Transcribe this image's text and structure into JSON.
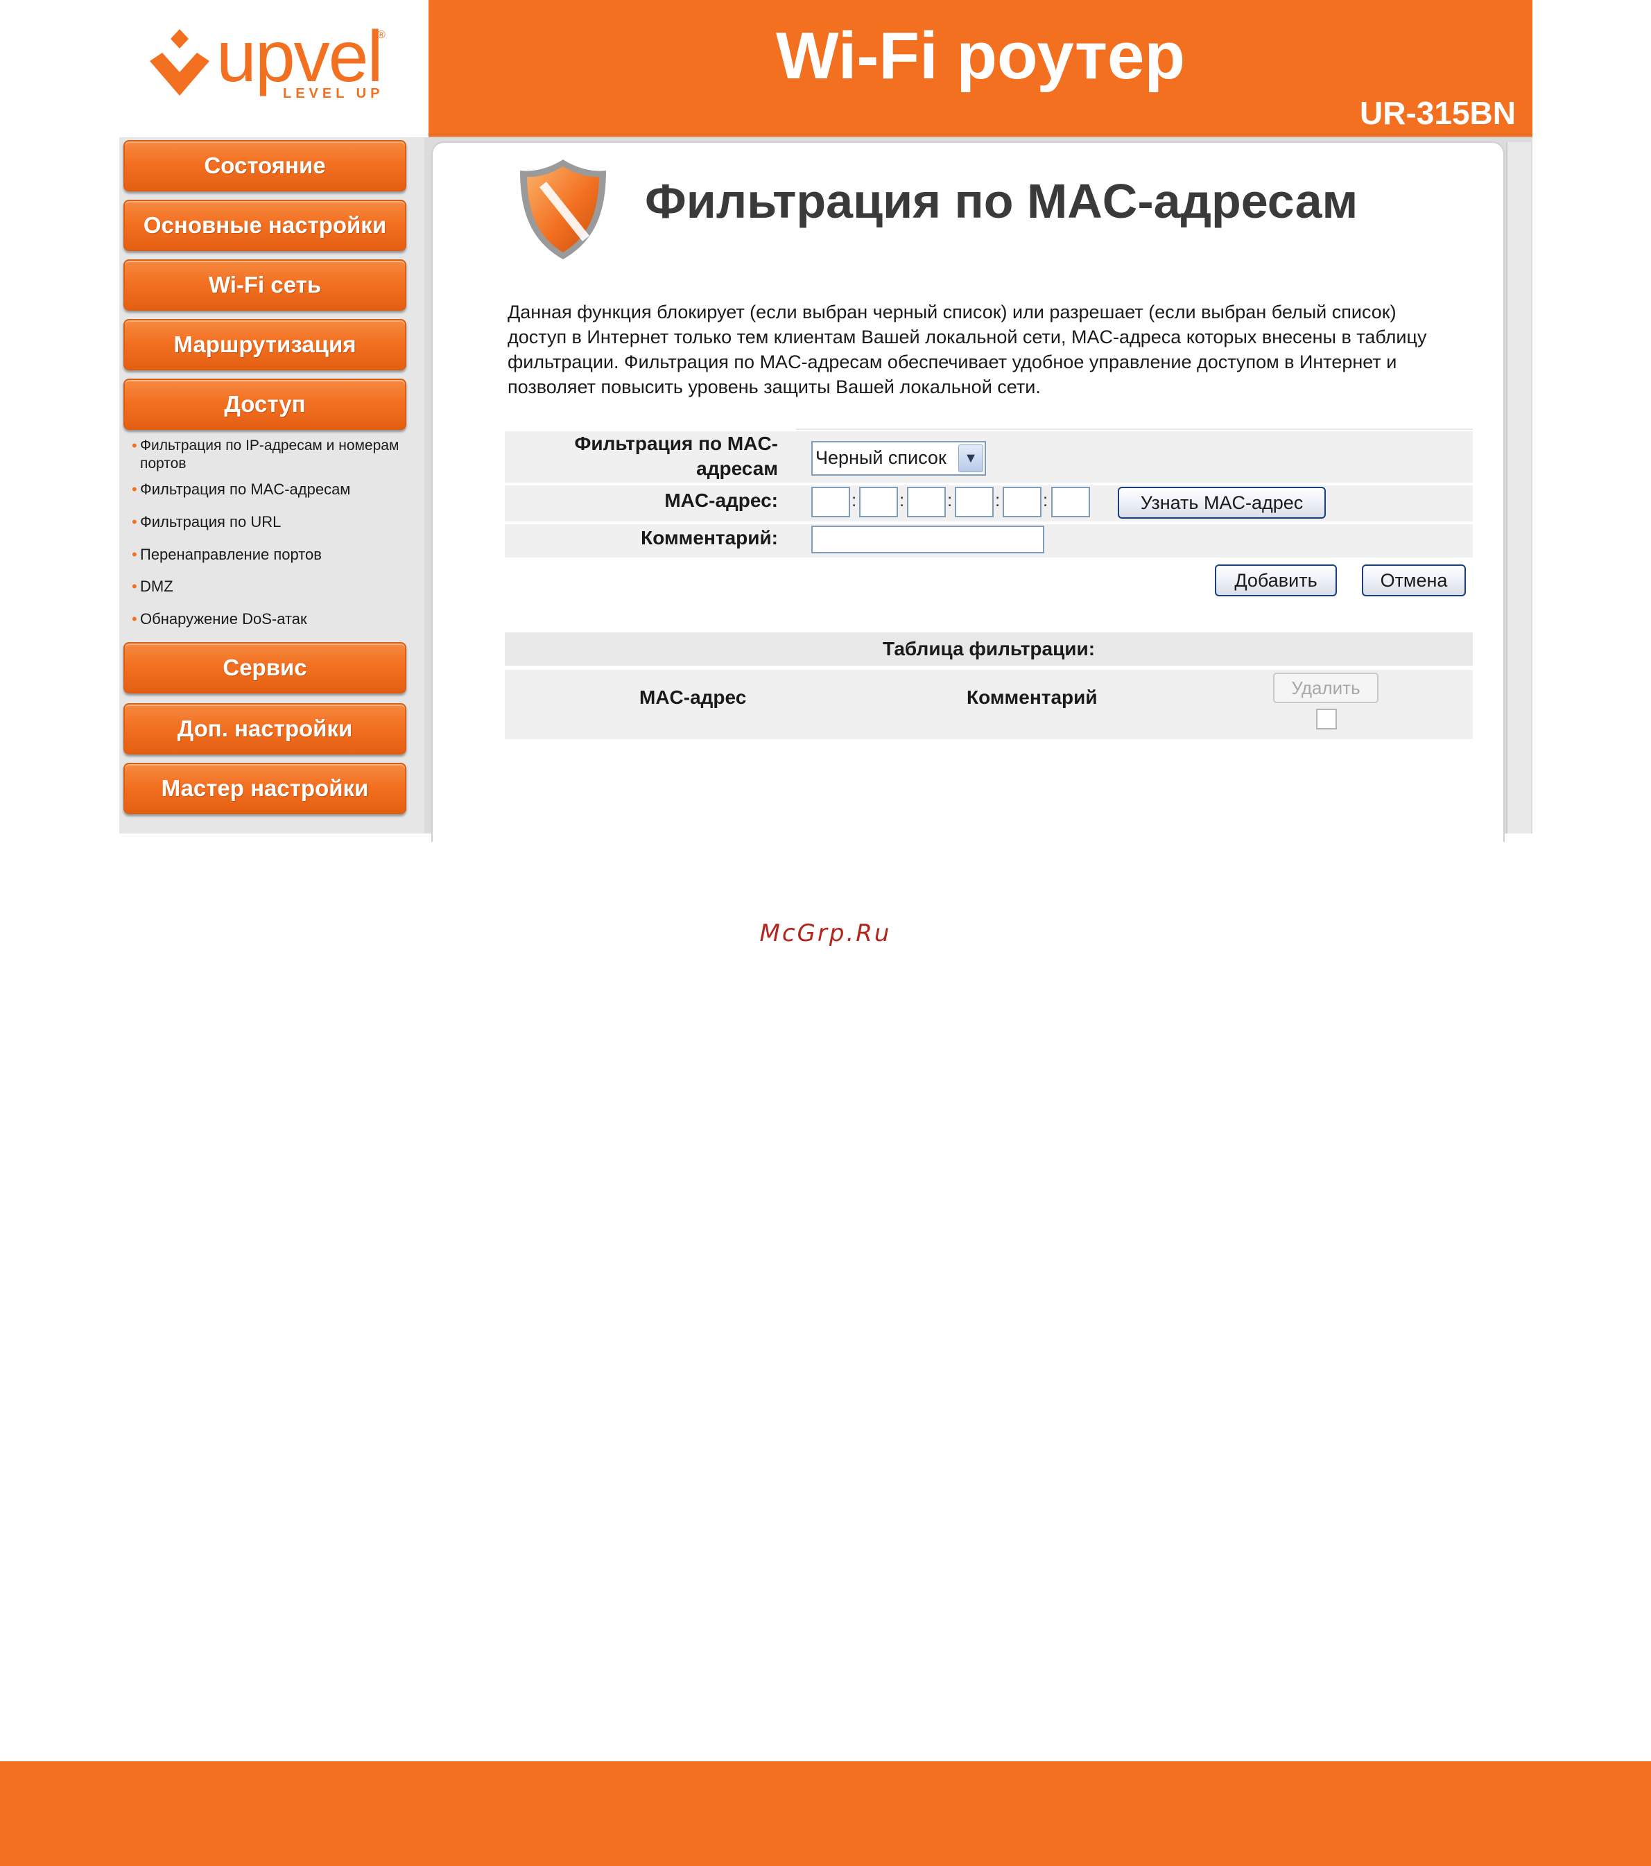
{
  "brand": {
    "logo_text": "upvel",
    "logo_tagline": "LEVEL UP",
    "logo_reg": "®",
    "color": "#f37021"
  },
  "header": {
    "title": "Wi-Fi роутер",
    "model": "UR-315BN"
  },
  "sidebar": {
    "items": [
      {
        "label": "Состояние"
      },
      {
        "label": "Основные настройки"
      },
      {
        "label": "Wi-Fi сеть"
      },
      {
        "label": "Маршрутизация"
      },
      {
        "label": "Доступ"
      },
      {
        "label": "Сервис"
      },
      {
        "label": "Доп. настройки"
      },
      {
        "label": "Мастер настройки"
      }
    ],
    "access_submenu": [
      "Фильтрация по IP-адресам и номерам портов",
      "Фильтрация по MAC-адресам",
      "Фильтрация по URL",
      "Перенаправление портов",
      "DMZ",
      "Обнаружение DoS-атак"
    ]
  },
  "page": {
    "icon": "shield-icon",
    "title": "Фильтрация по MAC-адресам",
    "description": "Данная функция блокирует (если выбран черный список) или разрешает (если выбран белый список) доступ в Интернет только тем клиентам Вашей локальной сети, MAC-адреса которых внесены в таблицу фильтрации. Фильтрация по MAC-адресам обеспечивает удобное управление доступом в Интернет и позволяет повысить уровень защиты Вашей локальной сети."
  },
  "form": {
    "mode_label_line1": "Фильтрация по MAC-",
    "mode_label_line2": "адресам",
    "mode_value": "Черный список",
    "mac_label": "MAC-адрес:",
    "mac_separator": ":",
    "get_mac_button": "Узнать MAC-адрес",
    "comment_label": "Комментарий:",
    "add_button": "Добавить",
    "cancel_button": "Отмена"
  },
  "table": {
    "title": "Таблица фильтрации:",
    "columns": [
      "MAC-адрес",
      "Комментарий"
    ],
    "delete_button": "Удалить"
  },
  "watermark": "McGrp.Ru"
}
